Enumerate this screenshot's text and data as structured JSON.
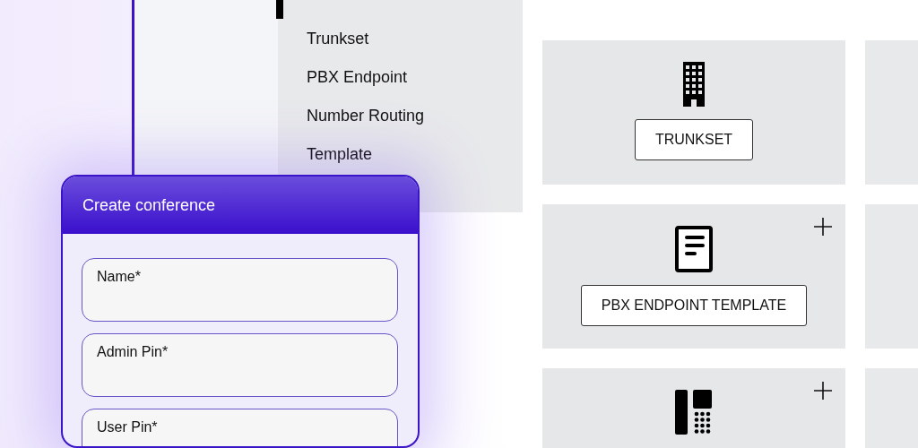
{
  "menu": {
    "items": [
      {
        "label": "Trunkset"
      },
      {
        "label": "PBX Endpoint"
      },
      {
        "label": "Number Routing"
      },
      {
        "label": "Template"
      }
    ]
  },
  "dialog": {
    "title": "Create conference",
    "fields": [
      {
        "label": "Name*"
      },
      {
        "label": "Admin Pin*"
      },
      {
        "label": "User Pin*"
      }
    ]
  },
  "cards": [
    {
      "kind": "building",
      "button": "TRUNKSET",
      "add": false
    },
    {
      "kind": "document",
      "button": "PBX ENDPOINT TEMPLATE",
      "add": true
    },
    {
      "kind": "phone",
      "add": true
    }
  ]
}
